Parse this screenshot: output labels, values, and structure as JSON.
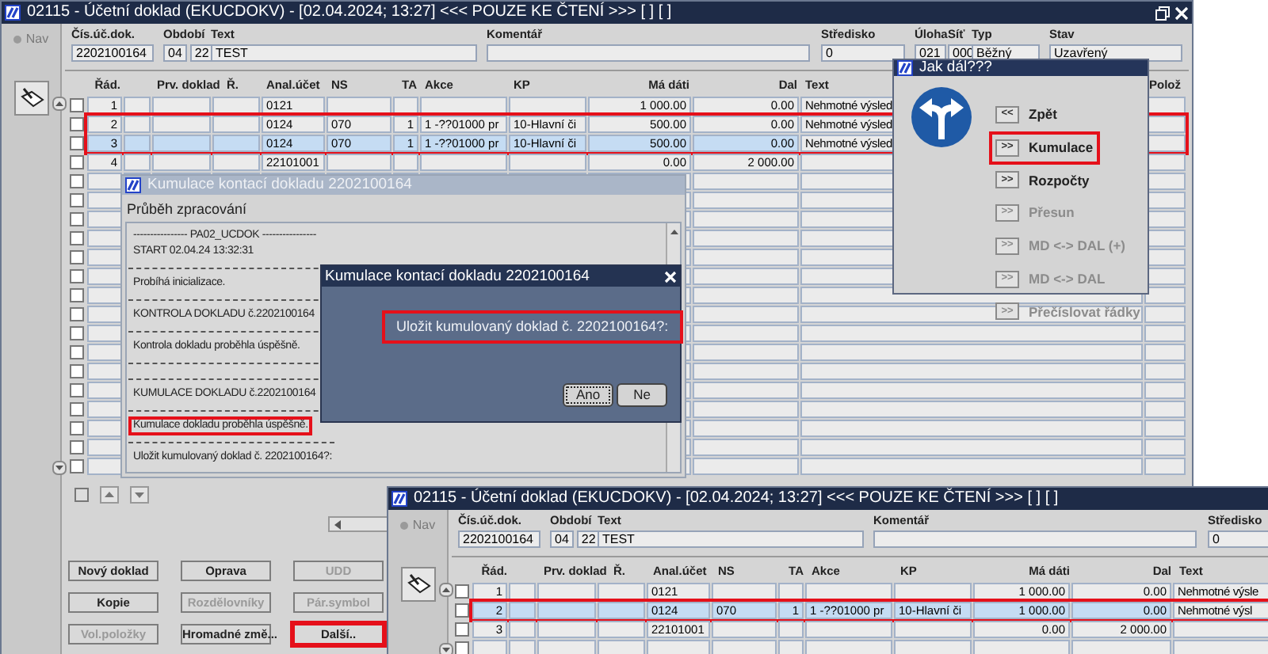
{
  "main_window": {
    "title": "02115 - Účetní doklad (EKUCDOKV) - [02.04.2024; 13:27] <<< POUZE KE ČTENÍ >>> [ ] [ ]",
    "nav_label": "Nav",
    "header": [
      {
        "label": "Čís.úč.dok.",
        "values": [
          "2202100164"
        ]
      },
      {
        "label": "Období",
        "values": [
          "04",
          "22"
        ]
      },
      {
        "label": "Text",
        "values": [
          "TEST"
        ]
      },
      {
        "label": "Komentář"
      },
      {
        "label": "Středisko",
        "values": [
          "0"
        ]
      },
      {
        "label": "Úloha",
        "values": [
          "021"
        ]
      },
      {
        "label": "Síť",
        "values": [
          "000"
        ]
      },
      {
        "label": "Typ",
        "values": [
          "Běžný"
        ]
      },
      {
        "label": "Stav",
        "values": [
          "Uzavřený"
        ]
      }
    ],
    "columns": {
      "rad": "Řád.",
      "prv_doklad": "Prv. doklad",
      "r": "Ř.",
      "anal_ucet": "Anal.účet",
      "ns": "NS",
      "ta": "TA",
      "akce": "Akce",
      "kp": "KP",
      "ma_dati": "Má dáti",
      "dal": "Dal",
      "text": "Text",
      "poloz": "Polož"
    },
    "rows": [
      {
        "checked": false,
        "selected": false,
        "highlighted": false,
        "cells": {
          "rad": "1",
          "anal_ucet": "0121",
          "ma_dati": "1 000.00",
          "dal": "0.00",
          "text": "Nehmotné výsled"
        }
      },
      {
        "checked": false,
        "selected": false,
        "highlighted": true,
        "cells": {
          "rad": "2",
          "anal_ucet": "0124",
          "ns": "070",
          "ta": "1",
          "akce": "1 -??01000 pr",
          "kp": "10-Hlavní či",
          "ma_dati": "500.00",
          "dal": "0.00",
          "text": "Nehmotné výsled"
        }
      },
      {
        "checked": false,
        "selected": true,
        "highlighted": true,
        "cells": {
          "rad": "3",
          "anal_ucet": "0124",
          "ns": "070",
          "ta": "1",
          "akce": "1 -??01000 pr",
          "kp": "10-Hlavní či",
          "ma_dati": "500.00",
          "dal": "0.00",
          "text": "Nehmotné výsled"
        }
      },
      {
        "checked": false,
        "selected": false,
        "highlighted": false,
        "cells": {
          "rad": "4",
          "anal_ucet": "22101001",
          "ma_dati": "0.00",
          "dal": "2 000.00"
        }
      },
      {
        "checked": false,
        "selected": false,
        "highlighted": false
      },
      {
        "checked": false,
        "selected": false,
        "highlighted": false
      },
      {
        "checked": false,
        "selected": false,
        "highlighted": false
      },
      {
        "checked": false,
        "selected": false,
        "highlighted": false
      },
      {
        "checked": false,
        "selected": false,
        "highlighted": false
      },
      {
        "checked": false,
        "selected": false,
        "highlighted": false
      },
      {
        "checked": false,
        "selected": false,
        "highlighted": false
      },
      {
        "checked": false,
        "selected": false,
        "highlighted": false
      },
      {
        "checked": false,
        "selected": false,
        "highlighted": false
      },
      {
        "checked": false,
        "selected": false,
        "highlighted": false
      },
      {
        "checked": false,
        "selected": false,
        "highlighted": false
      },
      {
        "checked": false,
        "selected": false,
        "highlighted": false
      },
      {
        "checked": false,
        "selected": false,
        "highlighted": false
      },
      {
        "checked": false,
        "selected": false,
        "highlighted": false
      },
      {
        "checked": false,
        "selected": false,
        "highlighted": false
      },
      {
        "checked": false,
        "selected": false,
        "highlighted": false
      }
    ],
    "select_all_checked": false,
    "buttons": [
      {
        "label": "Nový doklad",
        "disabled": false,
        "highlighted": false
      },
      {
        "label": "Oprava",
        "disabled": false,
        "highlighted": false
      },
      {
        "label": "UDD",
        "disabled": true,
        "highlighted": false
      },
      {
        "label": "Kopie",
        "disabled": false,
        "highlighted": false
      },
      {
        "label": "Rozdělovníky",
        "disabled": true,
        "highlighted": false
      },
      {
        "label": "Pár.symbol",
        "disabled": true,
        "highlighted": false
      },
      {
        "label": "Vol.položky",
        "disabled": true,
        "highlighted": false
      },
      {
        "label": "Hromadné změ...",
        "disabled": false,
        "highlighted": false
      },
      {
        "label": "Další..",
        "disabled": false,
        "highlighted": true
      }
    ]
  },
  "progress_window": {
    "title": "Kumulace kontací dokladu 2202100164",
    "subtitle": "Průběh zpracování",
    "log": [
      {
        "kind": "text",
        "text": "---------------- PA02_UCDOK ----------------",
        "highlighted": false
      },
      {
        "kind": "text",
        "text": "START 02.04.24 13:32:31",
        "highlighted": false
      },
      {
        "kind": "rule"
      },
      {
        "kind": "text",
        "text": "Probíhá inicializace.",
        "highlighted": false
      },
      {
        "kind": "rule"
      },
      {
        "kind": "text",
        "text": "KONTROLA DOKLADU č.2202100164",
        "highlighted": false
      },
      {
        "kind": "rule"
      },
      {
        "kind": "text",
        "text": "Kontrola dokladu proběhla úspěšně.",
        "highlighted": false
      },
      {
        "kind": "rule"
      },
      {
        "kind": "rule"
      },
      {
        "kind": "text",
        "text": "KUMULACE DOKLADU č.2202100164",
        "highlighted": false
      },
      {
        "kind": "rule"
      },
      {
        "kind": "text",
        "text": "Kumulace dokladu proběhla úspěšně.",
        "highlighted": true
      },
      {
        "kind": "rule"
      },
      {
        "kind": "text",
        "text": "Uložit kumulovaný doklad č. 2202100164?:",
        "highlighted": false
      }
    ]
  },
  "confirm_dialog": {
    "title": "Kumulace kontací dokladu 2202100164",
    "message": "Uložit kumulovaný doklad č. 2202100164?:",
    "message_highlighted": true,
    "buttons": [
      {
        "label": "Ano",
        "focused": true
      },
      {
        "label": "Ne",
        "focused": false
      }
    ]
  },
  "next_dialog": {
    "title": "Jak dál???",
    "options": [
      {
        "button": "<<",
        "label": "Zpět",
        "disabled": false,
        "highlighted": false
      },
      {
        "button": ">>",
        "label": "Kumulace",
        "disabled": false,
        "highlighted": true
      },
      {
        "button": ">>",
        "label": "Rozpočty",
        "disabled": false,
        "highlighted": false
      },
      {
        "button": ">>",
        "label": "Přesun",
        "disabled": true,
        "highlighted": false
      },
      {
        "button": ">>",
        "label": "MD <-> DAL (+)",
        "disabled": true,
        "highlighted": false
      },
      {
        "button": ">>",
        "label": "MD <-> DAL",
        "disabled": true,
        "highlighted": false
      },
      {
        "button": ">>",
        "label": "Přečíslovat řádky",
        "disabled": true,
        "highlighted": false
      }
    ]
  },
  "second_window": {
    "title": "02115 - Účetní doklad (EKUCDOKV) - [02.04.2024; 13:27] <<< POUZE KE ČTENÍ >>> [ ] [ ]",
    "nav_label": "Nav",
    "header": [
      {
        "label": "Čís.úč.dok.",
        "values": [
          "2202100164"
        ]
      },
      {
        "label": "Období",
        "values": [
          "04",
          "22"
        ]
      },
      {
        "label": "Text",
        "values": [
          "TEST"
        ]
      },
      {
        "label": "Komentář"
      },
      {
        "label": "Středisko",
        "values": [
          "0"
        ]
      }
    ],
    "columns": {
      "rad": "Řád.",
      "prv_doklad": "Prv. doklad",
      "r": "Ř.",
      "anal_ucet": "Anal.účet",
      "ns": "NS",
      "ta": "TA",
      "akce": "Akce",
      "kp": "KP",
      "ma_dati": "Má dáti",
      "dal": "Dal",
      "text": "Text"
    },
    "rows": [
      {
        "checked": false,
        "selected": false,
        "highlighted": false,
        "cells": {
          "rad": "1",
          "anal_ucet": "0121",
          "ma_dati": "1 000.00",
          "dal": "0.00",
          "text": "Nehmotné výsle"
        }
      },
      {
        "checked": false,
        "selected": true,
        "highlighted": true,
        "cells": {
          "rad": "2",
          "anal_ucet": "0124",
          "ns": "070",
          "ta": "1",
          "akce": "1 -??01000 pr",
          "kp": "10-Hlavní či",
          "ma_dati": "1 000.00",
          "dal": "0.00",
          "text": "Nehmotné výsl"
        }
      },
      {
        "checked": false,
        "selected": false,
        "highlighted": false,
        "cells": {
          "rad": "3",
          "anal_ucet": "22101001",
          "ma_dati": "0.00",
          "dal": "2 000.00"
        }
      },
      {
        "checked": false,
        "selected": false,
        "highlighted": false
      }
    ]
  }
}
